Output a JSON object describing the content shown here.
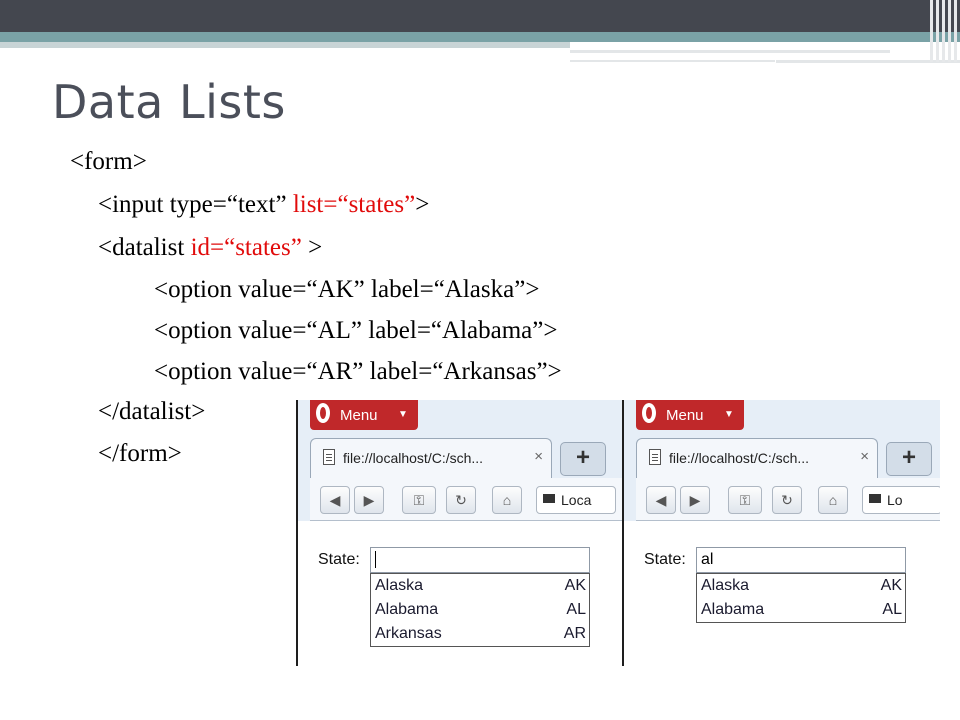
{
  "slide": {
    "title": "Data Lists",
    "code": [
      {
        "text": "<form>"
      },
      {
        "text": "<input type=“text” ",
        "red": "list=“states”",
        "after": ">"
      },
      {
        "text": "<datalist ",
        "red": "id=“states”",
        "after": " >"
      },
      {
        "text": "<option value=“AK” label=“Alaska”>"
      },
      {
        "text": "<option value=“AL” label=“Alabama”>"
      },
      {
        "text": "<option value=“AR” label=“Arkansas”>"
      },
      {
        "text": "</datalist>"
      },
      {
        "text": "</form>"
      }
    ]
  },
  "screenshots": [
    {
      "menu_label": "Menu",
      "tab_title": "file://localhost/C:/sch...",
      "tab_close": "×",
      "new_tab": "+",
      "address_text": "Loca",
      "field_label": "State:",
      "input_value": "",
      "options": [
        {
          "label": "Alaska",
          "value": "AK"
        },
        {
          "label": "Alabama",
          "value": "AL"
        },
        {
          "label": "Arkansas",
          "value": "AR"
        }
      ]
    },
    {
      "menu_label": "Menu",
      "tab_title": "file://localhost/C:/sch...",
      "tab_close": "×",
      "new_tab": "+",
      "address_text": "Lo",
      "field_label": "State:",
      "input_value": "al",
      "options": [
        {
          "label": "Alaska",
          "value": "AK"
        },
        {
          "label": "Alabama",
          "value": "AL"
        }
      ]
    }
  ],
  "icons": [
    "opera-logo-icon",
    "page-icon",
    "back-arrow-icon",
    "forward-arrow-icon",
    "key-icon",
    "reload-icon",
    "home-icon",
    "address-icon"
  ],
  "colors": {
    "accent_red": "#e10b0b",
    "opera_red": "#c0282a",
    "title_gray": "#4b4f5a",
    "teal": "#7aa2a6"
  }
}
